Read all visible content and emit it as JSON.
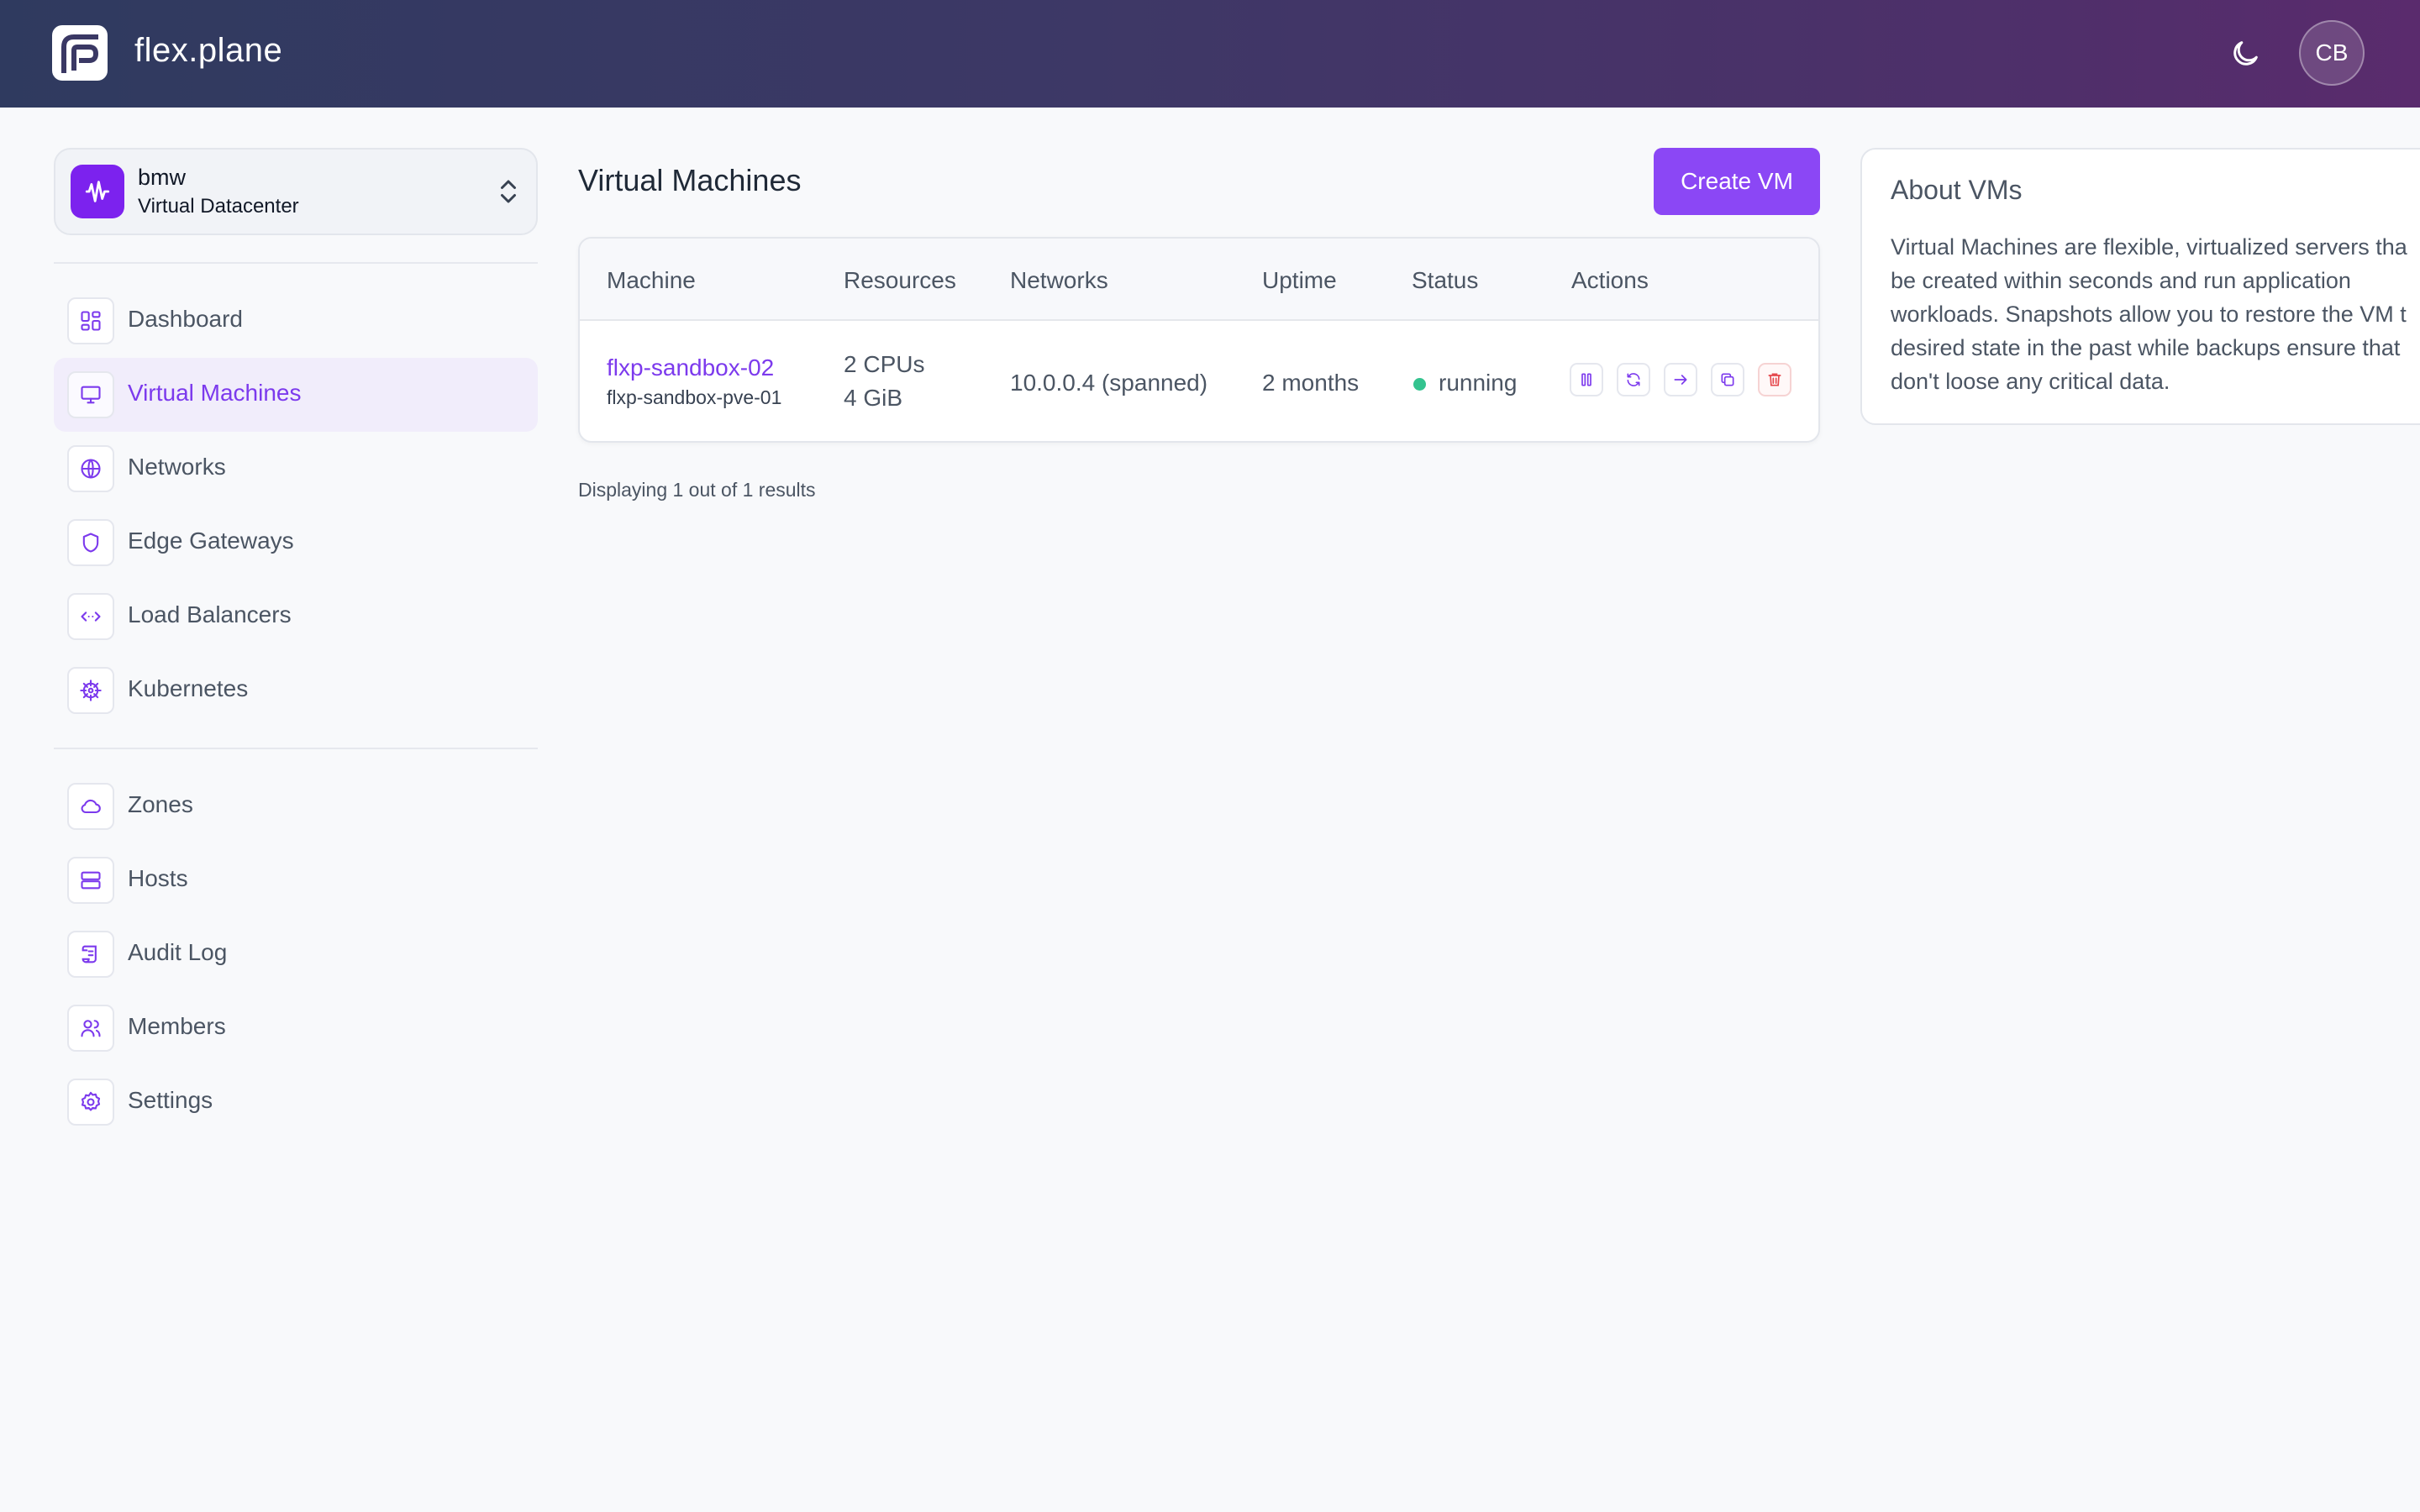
{
  "header": {
    "brand": "flex.plane",
    "avatar_initials": "CB",
    "theme_toggle_icon": "moon-icon",
    "gradient_colors": [
      "#2f3a5f",
      "#5a2b6d"
    ]
  },
  "datacenter": {
    "name": "bmw",
    "type": "Virtual Datacenter",
    "icon": "waveform-icon",
    "icon_color": "#7c22ee"
  },
  "sidebar": {
    "primary": [
      {
        "label": "Dashboard",
        "icon": "dashboard-icon",
        "active": false
      },
      {
        "label": "Virtual Machines",
        "icon": "monitor-icon",
        "active": true
      },
      {
        "label": "Networks",
        "icon": "globe-icon",
        "active": false
      },
      {
        "label": "Edge Gateways",
        "icon": "shield-icon",
        "active": false
      },
      {
        "label": "Load Balancers",
        "icon": "code-arrows-icon",
        "active": false
      },
      {
        "label": "Kubernetes",
        "icon": "helm-wheel-icon",
        "active": false
      }
    ],
    "secondary": [
      {
        "label": "Zones",
        "icon": "cloud-icon"
      },
      {
        "label": "Hosts",
        "icon": "server-icon"
      },
      {
        "label": "Audit Log",
        "icon": "scroll-icon"
      },
      {
        "label": "Members",
        "icon": "users-icon"
      },
      {
        "label": "Settings",
        "icon": "gear-icon"
      }
    ]
  },
  "main": {
    "title": "Virtual Machines",
    "create_button": "Create VM",
    "accent_color": "#8b47f5",
    "table": {
      "columns": [
        "Machine",
        "Resources",
        "Networks",
        "Uptime",
        "Status",
        "Actions"
      ],
      "rows": [
        {
          "name": "flxp-sandbox-02",
          "host": "flxp-sandbox-pve-01",
          "cpus": "2 CPUs",
          "memory": "4 GiB",
          "network": "10.0.0.4 (spanned)",
          "uptime": "2 months",
          "status": "running",
          "status_color": "#34c38f",
          "actions": [
            "pause-icon",
            "refresh-icon",
            "arrow-right-icon",
            "copy-icon",
            "trash-icon"
          ]
        }
      ]
    },
    "results_text": "Displaying 1 out of 1 results"
  },
  "about": {
    "title": "About VMs",
    "text": "Virtual Machines are flexible, virtualized servers tha\nbe created within seconds and run application\nworkloads. Snapshots allow you to restore the VM t\ndesired state in the past while backups ensure that\ndon't loose any critical data."
  }
}
